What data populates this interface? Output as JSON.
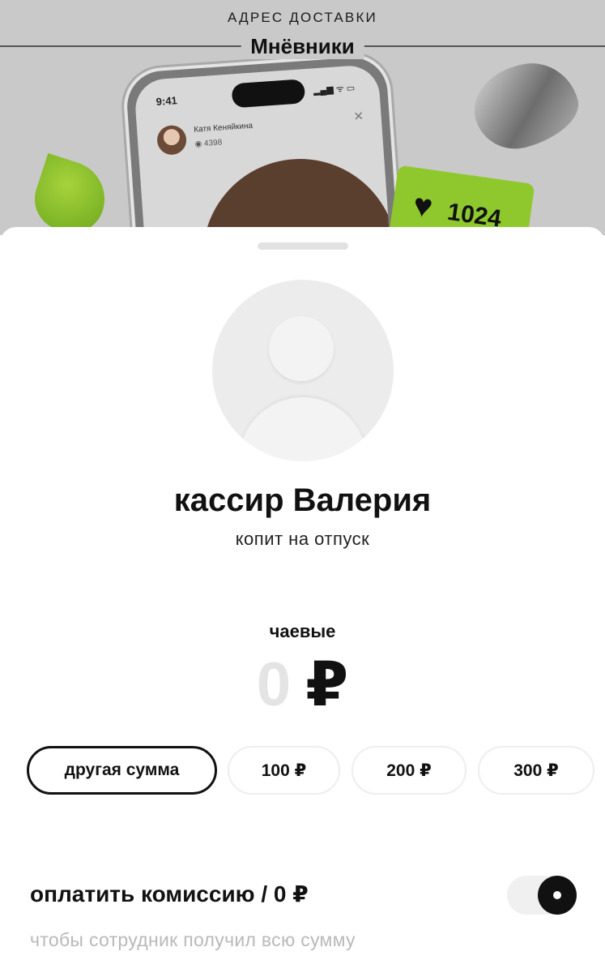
{
  "banner": {
    "header_label": "АДРЕС ДОСТАВКИ",
    "title": "Мнёвники",
    "phone": {
      "time": "9:41",
      "status": "▂▄▆ ᯤ ▭",
      "username": "Катя Кеняйкина",
      "views": "◉ 4398",
      "close": "×"
    },
    "like_badge": {
      "icon": "heart-icon",
      "count": "1024"
    }
  },
  "profile": {
    "name": "кассир Валерия",
    "goal": "копит на отпуск"
  },
  "tips": {
    "label": "чаевые",
    "amount": "0",
    "currency": "₽",
    "chips": [
      {
        "label": "другая сумма",
        "active": true
      },
      {
        "label": "100 ₽",
        "active": false
      },
      {
        "label": "200 ₽",
        "active": false
      },
      {
        "label": "300 ₽",
        "active": false
      }
    ]
  },
  "fee": {
    "label": "оплатить комиссию / 0 ₽",
    "hint": "чтобы сотрудник получил всю сумму",
    "toggle_on": true
  },
  "colors": {
    "accent": "#111111",
    "muted_text": "#b9b9b9",
    "amount_placeholder": "#e4e4e4",
    "banner_bg": "#c9c9c9",
    "like_badge": "#8fc82d"
  }
}
